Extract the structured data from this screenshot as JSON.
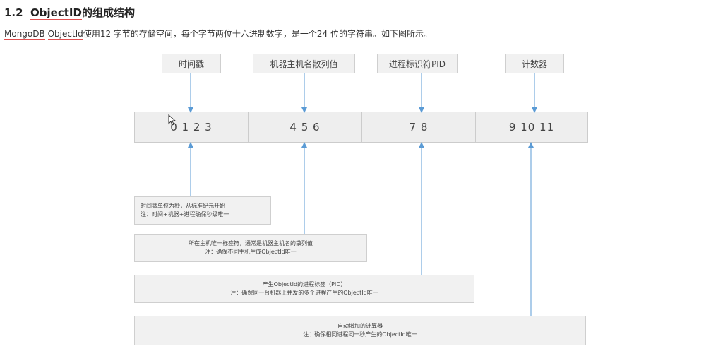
{
  "heading": {
    "number": "1.2",
    "title_underlined": "ObjectID",
    "title_rest": "的组成结构"
  },
  "description": {
    "text_a": "MongoDB",
    "text_b": " ",
    "text_c": "ObjectId",
    "text_d": "使用12 字节的存储空间，每个字节两位十六进制数字，是一个24 位的字符串。如下图所示。"
  },
  "diagram": {
    "top_labels": [
      "时间戳",
      "机器主机名散列值",
      "进程标识符PID",
      "计数器"
    ],
    "byte_groups": [
      "0   1   2   3",
      "4   5   6",
      "7   8",
      "9   10   11"
    ],
    "notes": [
      {
        "line1": "时间戳单位为秒，从标准纪元开始",
        "line2": "注：时间+机器+进程确保秒级唯一"
      },
      {
        "line1": "所在主机唯一标签符，通常是机器主机名的散列值",
        "line2": "注：确保不同主机生成ObjectId唯一"
      },
      {
        "line1": "产生ObjectId的进程标签（PID）",
        "line2": "注：确保同一台机器上并发的多个进程产生的ObjectId唯一"
      },
      {
        "line1": "自动增加的计算器",
        "line2": "注：确保相同进程同一秒产生的ObjectId唯一"
      }
    ]
  }
}
